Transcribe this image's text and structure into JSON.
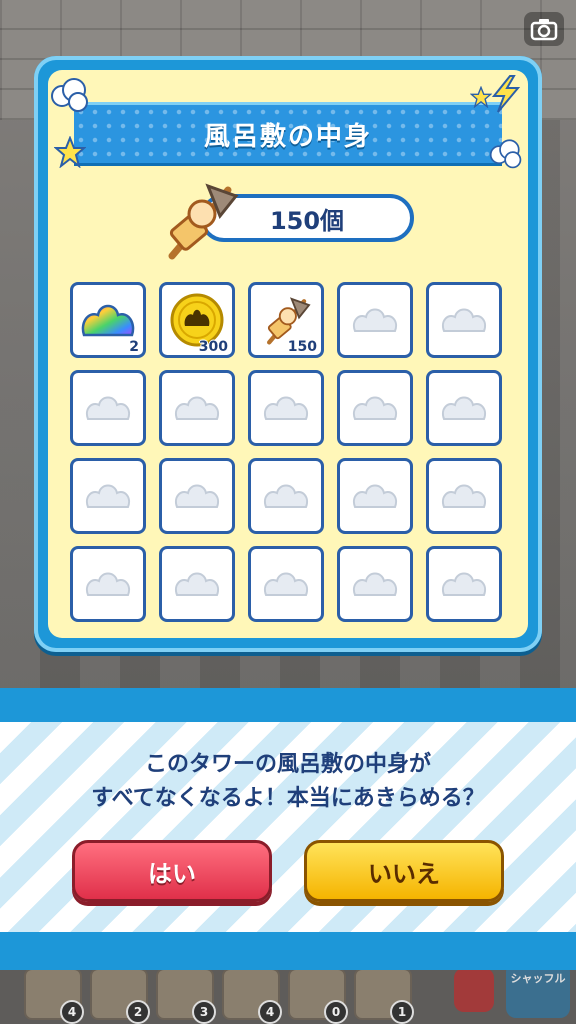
{
  "panel": {
    "title": "風呂敷の中身",
    "count_label": "150個",
    "items": [
      {
        "icon": "rainbow-matsu-icon",
        "count": "2"
      },
      {
        "icon": "gold-coin-icon",
        "count": "300"
      },
      {
        "icon": "oden-skewer-icon",
        "count": "150"
      }
    ],
    "empty_slots": 17
  },
  "dialog": {
    "line1": "このタワーの風呂敷の中身が",
    "line2": "すべてなくなるよ！本当にあきらめる？",
    "yes_label": "はい",
    "no_label": "いいえ"
  },
  "background": {
    "bottom_counts": [
      "4",
      "2",
      "3",
      "4",
      "0",
      "1"
    ],
    "shuffle_label": "シャッフル"
  },
  "colors": {
    "panel_blue": "#1d97d8",
    "panel_cream": "#fff7b8",
    "text_navy": "#1f3f7a",
    "yes_red": "#e0304a",
    "no_yellow": "#f5b400"
  }
}
